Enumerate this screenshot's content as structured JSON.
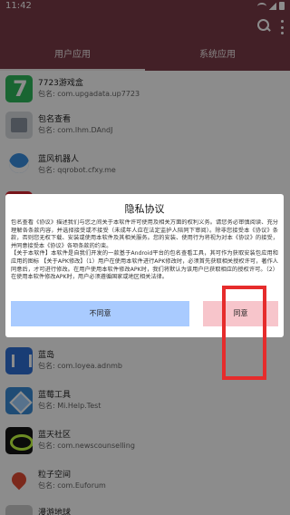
{
  "status_bar": {
    "time": "11:42"
  },
  "tabs": [
    {
      "label": "用户应用",
      "active": true
    },
    {
      "label": "系统应用",
      "active": false
    }
  ],
  "apps": [
    {
      "name": "7723游戏盒",
      "package": "包名: com.upgadata.up7723",
      "icon": "number-7-icon"
    },
    {
      "name": "包名查看",
      "package": "包名: com.lhm.DAndJ",
      "icon": "box-icon"
    },
    {
      "name": "蓝风机器人",
      "package": "包名: qqrobot.cfxy.me",
      "icon": "robot-icon"
    },
    {
      "name": "",
      "package": "",
      "icon": "red-app-icon"
    },
    {
      "name": "蓝岛",
      "package": "包名: com.loyea.adnmb",
      "icon": "blue-bars-icon"
    },
    {
      "name": "蓝莓工具",
      "package": "包名: Mi.Help.Test",
      "icon": "cube-icon"
    },
    {
      "name": "蓝天社区",
      "package": "包名: com.newscounselling",
      "icon": "ring-icon"
    },
    {
      "name": "粒子空间",
      "package": "包名: com.Euforum",
      "icon": "flower-icon"
    },
    {
      "name": "漫游地球",
      "package": "",
      "icon": "app-icon"
    }
  ],
  "dialog": {
    "title": "隐私协议",
    "paragraphs": [
      "包名查看《协议》描述我们与您之间关于本软件许可使用及相关方面的权利义务。请您务必审慎阅读、充分理解各条款内容，并选择接受或不接受（未成年人应在法定监护人陪同下审阅）。除非您接受本《协议》条款，否则您无权下载、安装或使用本软件及其相关服务。您的安装、使用行为将视为对本《协议》的接受，并同意接受本《协议》各项条款的约束。",
      "【关于本软件】本软件是自我们开发的一款基于Android平台的包名查看工具，其可作为获取安装包应用和应用的图标 【关于APK修改】（1）用户在使用本软件进行APK修改时，必须首先获取相关授权许可，著作人同意后，才可进行修改。在用户使用本软件修改APK时，我们将默认为该用户已获取相应的授权许可。（2）在使用本软件修改APK时，用户必须遵循国家或地区相关法律。"
    ],
    "disagree_label": "不同意",
    "agree_label": "同意"
  },
  "colors": {
    "app_bar": "#7b3b47",
    "disagree_button": "#a9cbff",
    "agree_button": "#f7c5cb",
    "highlight_border": "#e62c2c"
  }
}
